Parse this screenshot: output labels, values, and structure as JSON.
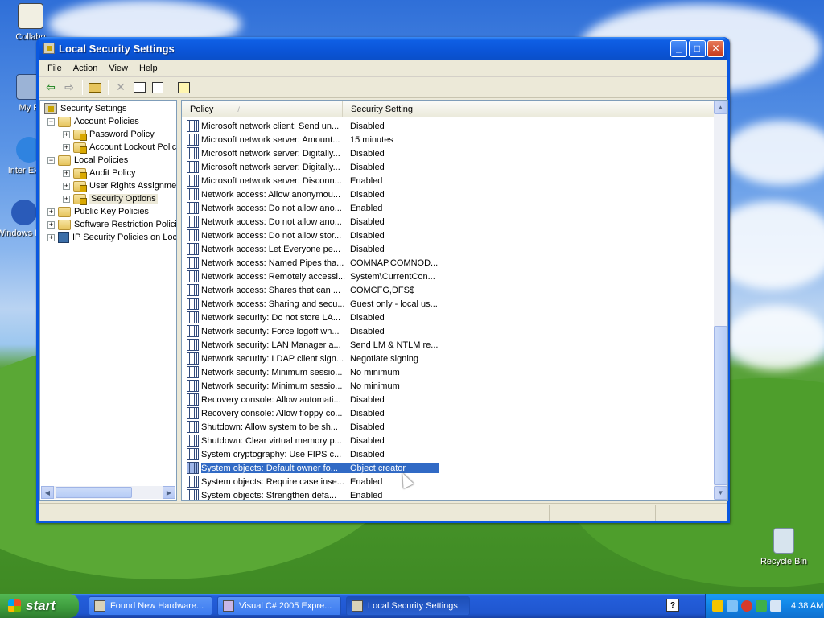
{
  "desktop": {
    "icons": [
      {
        "label": "Collabo"
      },
      {
        "label": "My P"
      },
      {
        "label": "Inter Explo"
      },
      {
        "label": "Windows Play"
      },
      {
        "label": "Recycle Bin"
      }
    ]
  },
  "window": {
    "title": "Local Security Settings",
    "menu": [
      "File",
      "Action",
      "View",
      "Help"
    ]
  },
  "tree": {
    "items": [
      {
        "label": "Security Settings"
      },
      {
        "label": "Account Policies"
      },
      {
        "label": "Password Policy"
      },
      {
        "label": "Account Lockout Policy"
      },
      {
        "label": "Local Policies"
      },
      {
        "label": "Audit Policy"
      },
      {
        "label": "User Rights Assignment"
      },
      {
        "label": "Security Options"
      },
      {
        "label": "Public Key Policies"
      },
      {
        "label": "Software Restriction Policies"
      },
      {
        "label": "IP Security Policies on Local Computer"
      }
    ]
  },
  "list": {
    "columns": {
      "policy": "Policy",
      "setting": "Security Setting",
      "sort_glyph": "/"
    },
    "rows": [
      {
        "policy": "Microsoft network client: Send un...",
        "setting": "Disabled"
      },
      {
        "policy": "Microsoft network server: Amount...",
        "setting": "15 minutes"
      },
      {
        "policy": "Microsoft network server: Digitally...",
        "setting": "Disabled"
      },
      {
        "policy": "Microsoft network server: Digitally...",
        "setting": "Disabled"
      },
      {
        "policy": "Microsoft network server: Disconn...",
        "setting": "Enabled"
      },
      {
        "policy": "Network access: Allow anonymou...",
        "setting": "Disabled"
      },
      {
        "policy": "Network access: Do not allow ano...",
        "setting": "Enabled"
      },
      {
        "policy": "Network access: Do not allow ano...",
        "setting": "Disabled"
      },
      {
        "policy": "Network access: Do not allow stor...",
        "setting": "Disabled"
      },
      {
        "policy": "Network access: Let Everyone pe...",
        "setting": "Disabled"
      },
      {
        "policy": "Network access: Named Pipes tha...",
        "setting": "COMNAP,COMNOD..."
      },
      {
        "policy": "Network access: Remotely accessi...",
        "setting": "System\\CurrentCon..."
      },
      {
        "policy": "Network access: Shares that can ...",
        "setting": "COMCFG,DFS$"
      },
      {
        "policy": "Network access: Sharing and secu...",
        "setting": "Guest only - local us..."
      },
      {
        "policy": "Network security: Do not store LA...",
        "setting": "Disabled"
      },
      {
        "policy": "Network security: Force logoff wh...",
        "setting": "Disabled"
      },
      {
        "policy": "Network security: LAN Manager a...",
        "setting": "Send LM & NTLM re..."
      },
      {
        "policy": "Network security: LDAP client sign...",
        "setting": "Negotiate signing"
      },
      {
        "policy": "Network security: Minimum sessio...",
        "setting": "No minimum"
      },
      {
        "policy": "Network security: Minimum sessio...",
        "setting": "No minimum"
      },
      {
        "policy": "Recovery console: Allow automati...",
        "setting": "Disabled"
      },
      {
        "policy": "Recovery console: Allow floppy co...",
        "setting": "Disabled"
      },
      {
        "policy": "Shutdown: Allow system to be sh...",
        "setting": "Disabled"
      },
      {
        "policy": "Shutdown: Clear virtual memory p...",
        "setting": "Disabled"
      },
      {
        "policy": "System cryptography: Use FIPS c...",
        "setting": "Disabled"
      },
      {
        "policy": "System objects: Default owner fo...",
        "setting": "Object creator"
      },
      {
        "policy": "System objects: Require case inse...",
        "setting": "Enabled"
      },
      {
        "policy": "System objects: Strengthen defa...",
        "setting": "Enabled"
      }
    ],
    "selected_index": 25
  },
  "taskbar": {
    "start_label": "start",
    "tasks": [
      {
        "label": "Found New Hardware..."
      },
      {
        "label": "Visual C# 2005 Expre..."
      },
      {
        "label": "Local Security Settings"
      }
    ],
    "clock": "4:38 AM",
    "help_glyph": "?"
  },
  "colors": {
    "selection": "#316ac5",
    "titlebar": "#0b55d8",
    "taskbar": "#245edb",
    "start_button": "#3c9a3c"
  }
}
